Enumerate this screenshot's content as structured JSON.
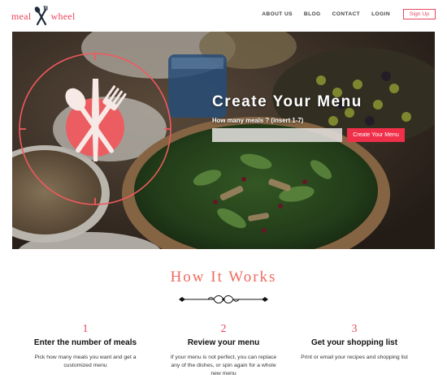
{
  "header": {
    "logo_left": "meal",
    "logo_right": "wheel",
    "logo_icon": "fork-knife-icon",
    "nav": [
      {
        "label": "ABOUT US"
      },
      {
        "label": "BLOG"
      },
      {
        "label": "CONTACT"
      },
      {
        "label": "LOGIN"
      }
    ],
    "signup_label": "Sign Up"
  },
  "hero": {
    "title": "Create Your Menu",
    "prompt_label": "How many meals ? (insert 1-7)",
    "input_value": "",
    "input_placeholder": "",
    "button_label": "Create Your Menu",
    "emblem_icon": "spoon-knife-fork-icon"
  },
  "how": {
    "title": "How It Works",
    "ornament_icon": "flourish-divider-icon",
    "steps": [
      {
        "num": "1",
        "title": "Enter the number of meals",
        "desc": "Pick how many meals you want and get a customized menu"
      },
      {
        "num": "2",
        "title": "Review your menu",
        "desc": "If your menu is not perfect, you can replace any of the dishes, or spin again for a whole new menu"
      },
      {
        "num": "3",
        "title": "Get your shopping list",
        "desc": "Print or email your recipes and shopping list"
      }
    ]
  },
  "colors": {
    "accent": "#e8475d",
    "button": "#f0304a",
    "heading": "#ef6a5e"
  }
}
